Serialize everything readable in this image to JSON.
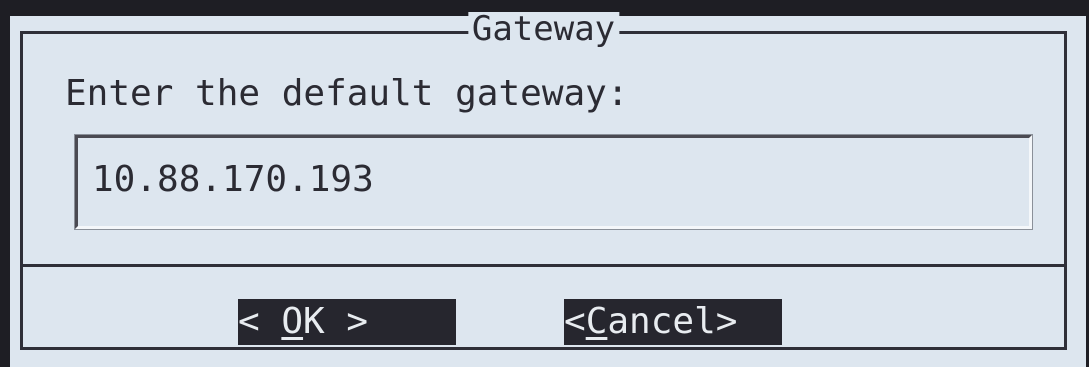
{
  "dialog": {
    "title": "Gateway",
    "prompt": "Enter the default gateway:",
    "input_value": "10.88.170.193"
  },
  "buttons": {
    "ok": {
      "left_bracket": "< ",
      "hotkey": "O",
      "rest": "K",
      "right_bracket": " >"
    },
    "cancel": {
      "left_bracket": "<",
      "hotkey": "C",
      "rest": "ancel",
      "right_bracket": ">"
    }
  },
  "colors": {
    "screen_background": "#1e1e24",
    "dialog_background": "#dde6ef",
    "border": "#2f2f38",
    "text": "#2b2b33",
    "button_background": "#26262e",
    "button_text": "#e8ecf0"
  }
}
